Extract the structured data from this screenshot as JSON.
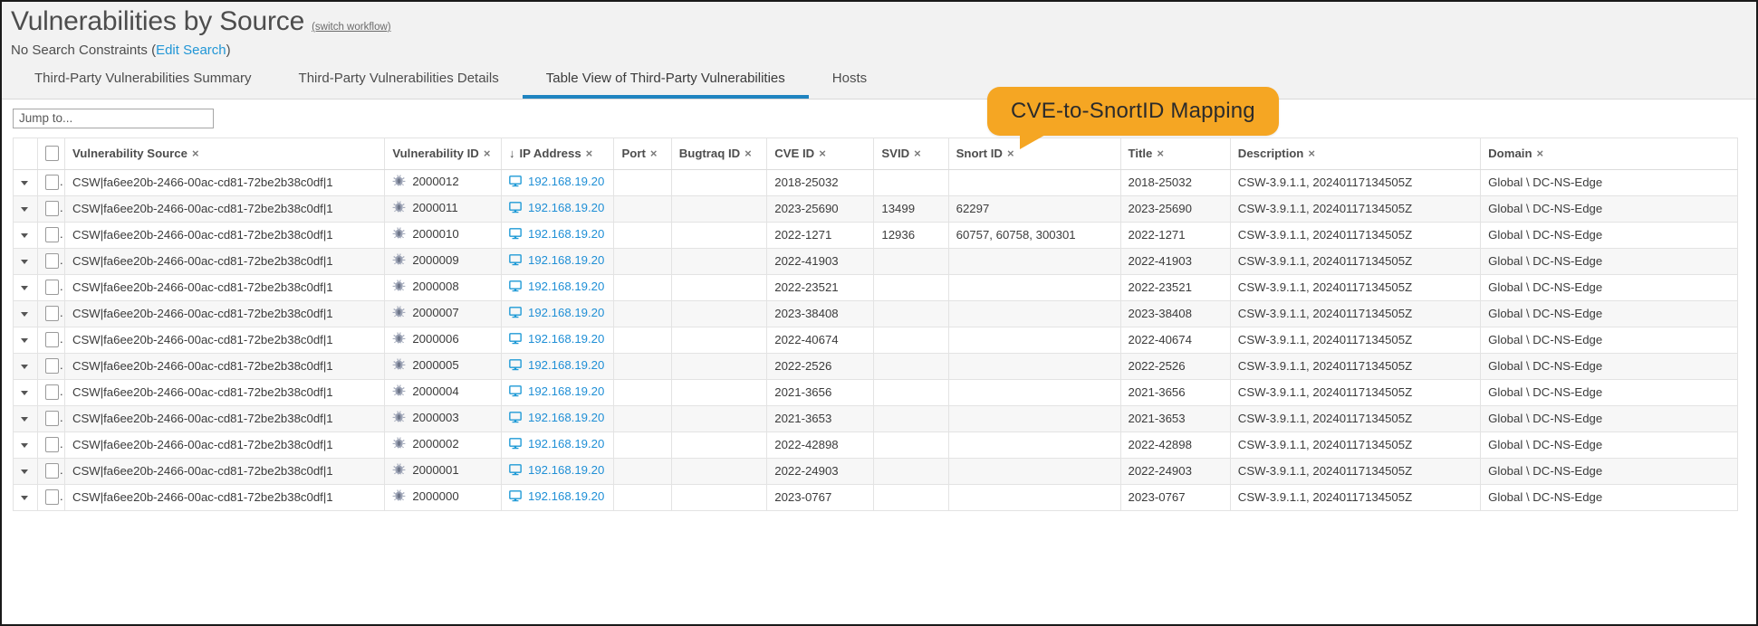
{
  "header": {
    "title": "Vulnerabilities by Source",
    "switch_workflow": "(switch workflow)",
    "constraints_text": "No Search Constraints (",
    "edit_search": "Edit Search",
    "constraints_close": ")"
  },
  "tabs": [
    {
      "label": "Third-Party Vulnerabilities Summary",
      "active": false
    },
    {
      "label": "Third-Party Vulnerabilities Details",
      "active": false
    },
    {
      "label": "Table View of Third-Party Vulnerabilities",
      "active": true
    },
    {
      "label": "Hosts",
      "active": false
    }
  ],
  "jump_to": {
    "value": "",
    "placeholder": "Jump to..."
  },
  "callout": {
    "text": "CVE-to-SnortID Mapping",
    "color": "#f5a623"
  },
  "table": {
    "columns": [
      {
        "label": "Vulnerability Source",
        "sorted": false
      },
      {
        "label": "Vulnerability ID",
        "sorted": false
      },
      {
        "label": "IP Address",
        "sorted": true
      },
      {
        "label": "Port",
        "sorted": false
      },
      {
        "label": "Bugtraq ID",
        "sorted": false
      },
      {
        "label": "CVE ID",
        "sorted": false
      },
      {
        "label": "SVID",
        "sorted": false
      },
      {
        "label": "Snort ID",
        "sorted": false
      },
      {
        "label": "Title",
        "sorted": false
      },
      {
        "label": "Description",
        "sorted": false
      },
      {
        "label": "Domain",
        "sorted": false
      }
    ],
    "close_glyph": "×",
    "sort_glyph": "↓",
    "rows": [
      {
        "source": "CSW|fa6ee20b-2466-00ac-cd81-72be2b38c0df|1",
        "vuln_id": "2000012",
        "ip": "192.168.19.20",
        "port": "",
        "bugtraq": "",
        "cve": "2018-25032",
        "svid": "",
        "snort": "",
        "title": "2018-25032",
        "description": "CSW-3.9.1.1, 20240117134505Z",
        "domain": "Global \\ DC-NS-Edge"
      },
      {
        "source": "CSW|fa6ee20b-2466-00ac-cd81-72be2b38c0df|1",
        "vuln_id": "2000011",
        "ip": "192.168.19.20",
        "port": "",
        "bugtraq": "",
        "cve": "2023-25690",
        "svid": "13499",
        "snort": "62297",
        "title": "2023-25690",
        "description": "CSW-3.9.1.1, 20240117134505Z",
        "domain": "Global \\ DC-NS-Edge"
      },
      {
        "source": "CSW|fa6ee20b-2466-00ac-cd81-72be2b38c0df|1",
        "vuln_id": "2000010",
        "ip": "192.168.19.20",
        "port": "",
        "bugtraq": "",
        "cve": "2022-1271",
        "svid": "12936",
        "snort": "60757, 60758, 300301",
        "title": "2022-1271",
        "description": "CSW-3.9.1.1, 20240117134505Z",
        "domain": "Global \\ DC-NS-Edge"
      },
      {
        "source": "CSW|fa6ee20b-2466-00ac-cd81-72be2b38c0df|1",
        "vuln_id": "2000009",
        "ip": "192.168.19.20",
        "port": "",
        "bugtraq": "",
        "cve": "2022-41903",
        "svid": "",
        "snort": "",
        "title": "2022-41903",
        "description": "CSW-3.9.1.1, 20240117134505Z",
        "domain": "Global \\ DC-NS-Edge"
      },
      {
        "source": "CSW|fa6ee20b-2466-00ac-cd81-72be2b38c0df|1",
        "vuln_id": "2000008",
        "ip": "192.168.19.20",
        "port": "",
        "bugtraq": "",
        "cve": "2022-23521",
        "svid": "",
        "snort": "",
        "title": "2022-23521",
        "description": "CSW-3.9.1.1, 20240117134505Z",
        "domain": "Global \\ DC-NS-Edge"
      },
      {
        "source": "CSW|fa6ee20b-2466-00ac-cd81-72be2b38c0df|1",
        "vuln_id": "2000007",
        "ip": "192.168.19.20",
        "port": "",
        "bugtraq": "",
        "cve": "2023-38408",
        "svid": "",
        "snort": "",
        "title": "2023-38408",
        "description": "CSW-3.9.1.1, 20240117134505Z",
        "domain": "Global \\ DC-NS-Edge"
      },
      {
        "source": "CSW|fa6ee20b-2466-00ac-cd81-72be2b38c0df|1",
        "vuln_id": "2000006",
        "ip": "192.168.19.20",
        "port": "",
        "bugtraq": "",
        "cve": "2022-40674",
        "svid": "",
        "snort": "",
        "title": "2022-40674",
        "description": "CSW-3.9.1.1, 20240117134505Z",
        "domain": "Global \\ DC-NS-Edge"
      },
      {
        "source": "CSW|fa6ee20b-2466-00ac-cd81-72be2b38c0df|1",
        "vuln_id": "2000005",
        "ip": "192.168.19.20",
        "port": "",
        "bugtraq": "",
        "cve": "2022-2526",
        "svid": "",
        "snort": "",
        "title": "2022-2526",
        "description": "CSW-3.9.1.1, 20240117134505Z",
        "domain": "Global \\ DC-NS-Edge"
      },
      {
        "source": "CSW|fa6ee20b-2466-00ac-cd81-72be2b38c0df|1",
        "vuln_id": "2000004",
        "ip": "192.168.19.20",
        "port": "",
        "bugtraq": "",
        "cve": "2021-3656",
        "svid": "",
        "snort": "",
        "title": "2021-3656",
        "description": "CSW-3.9.1.1, 20240117134505Z",
        "domain": "Global \\ DC-NS-Edge"
      },
      {
        "source": "CSW|fa6ee20b-2466-00ac-cd81-72be2b38c0df|1",
        "vuln_id": "2000003",
        "ip": "192.168.19.20",
        "port": "",
        "bugtraq": "",
        "cve": "2021-3653",
        "svid": "",
        "snort": "",
        "title": "2021-3653",
        "description": "CSW-3.9.1.1, 20240117134505Z",
        "domain": "Global \\ DC-NS-Edge"
      },
      {
        "source": "CSW|fa6ee20b-2466-00ac-cd81-72be2b38c0df|1",
        "vuln_id": "2000002",
        "ip": "192.168.19.20",
        "port": "",
        "bugtraq": "",
        "cve": "2022-42898",
        "svid": "",
        "snort": "",
        "title": "2022-42898",
        "description": "CSW-3.9.1.1, 20240117134505Z",
        "domain": "Global \\ DC-NS-Edge"
      },
      {
        "source": "CSW|fa6ee20b-2466-00ac-cd81-72be2b38c0df|1",
        "vuln_id": "2000001",
        "ip": "192.168.19.20",
        "port": "",
        "bugtraq": "",
        "cve": "2022-24903",
        "svid": "",
        "snort": "",
        "title": "2022-24903",
        "description": "CSW-3.9.1.1, 20240117134505Z",
        "domain": "Global \\ DC-NS-Edge"
      },
      {
        "source": "CSW|fa6ee20b-2466-00ac-cd81-72be2b38c0df|1",
        "vuln_id": "2000000",
        "ip": "192.168.19.20",
        "port": "",
        "bugtraq": "",
        "cve": "2023-0767",
        "svid": "",
        "snort": "",
        "title": "2023-0767",
        "description": "CSW-3.9.1.1, 20240117134505Z",
        "domain": "Global \\ DC-NS-Edge"
      }
    ]
  }
}
